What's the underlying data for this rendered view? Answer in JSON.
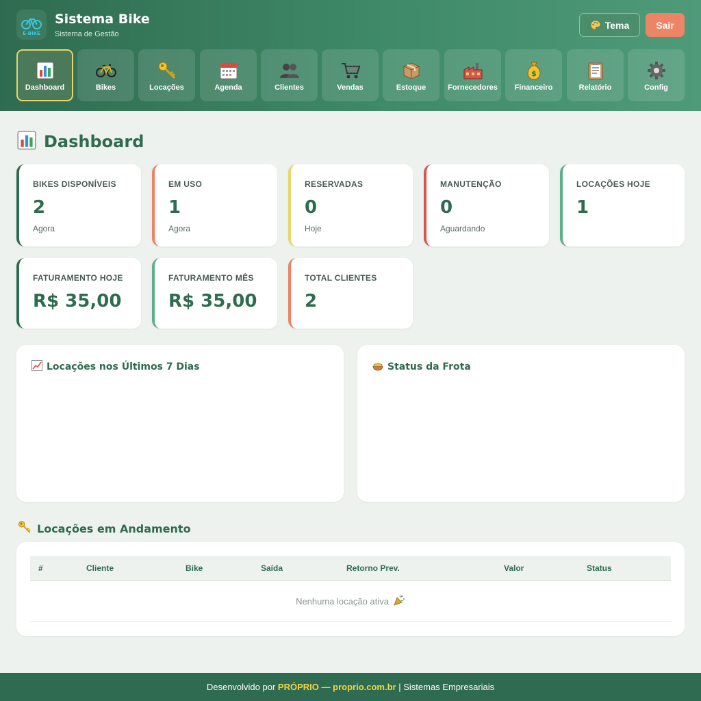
{
  "header": {
    "logo_text": "E-BIKE",
    "title": "Sistema Bike",
    "subtitle": "Sistema de Gestão",
    "theme_button": "Tema",
    "logout_button": "Sair"
  },
  "nav": {
    "items": [
      {
        "label": "Dashboard",
        "icon": "bar-chart-icon",
        "active": true
      },
      {
        "label": "Bikes",
        "icon": "bicycle-icon"
      },
      {
        "label": "Locações",
        "icon": "key-icon"
      },
      {
        "label": "Agenda",
        "icon": "calendar-icon"
      },
      {
        "label": "Clientes",
        "icon": "users-icon"
      },
      {
        "label": "Vendas",
        "icon": "cart-icon"
      },
      {
        "label": "Estoque",
        "icon": "box-icon"
      },
      {
        "label": "Fornecedores",
        "icon": "factory-icon"
      },
      {
        "label": "Financeiro",
        "icon": "money-bag-icon"
      },
      {
        "label": "Relatório",
        "icon": "clipboard-icon"
      },
      {
        "label": "Config",
        "icon": "gear-icon"
      }
    ]
  },
  "page": {
    "title": "Dashboard"
  },
  "stats": [
    {
      "label": "BIKES DISPONÍVEIS",
      "value": "2",
      "note": "Agora",
      "color": "#2f6b50"
    },
    {
      "label": "EM USO",
      "value": "1",
      "note": "Agora",
      "color": "#ee8466"
    },
    {
      "label": "RESERVADAS",
      "value": "0",
      "note": "Hoje",
      "color": "#e8d66a"
    },
    {
      "label": "MANUTENÇÃO",
      "value": "0",
      "note": "Aguardando",
      "color": "#d9534f"
    },
    {
      "label": "LOCAÇÕES HOJE",
      "value": "1",
      "note": "",
      "color": "#5cb08a"
    },
    {
      "label": "FATURAMENTO HOJE",
      "value": "R$ 35,00",
      "note": "",
      "color": "#2f6b50"
    },
    {
      "label": "FATURAMENTO MÊS",
      "value": "R$ 35,00",
      "note": "",
      "color": "#5cb08a"
    },
    {
      "label": "TOTAL CLIENTES",
      "value": "2",
      "note": "",
      "color": "#ee8466"
    }
  ],
  "panels": {
    "rentals_chart_title": "Locações nos Últimos 7 Dias",
    "fleet_status_title": "Status da Frota"
  },
  "active_rentals": {
    "title": "Locações em Andamento",
    "columns": [
      "#",
      "Cliente",
      "Bike",
      "Saída",
      "Retorno Prev.",
      "Valor",
      "Status"
    ],
    "empty_message": "Nenhuma locação ativa"
  },
  "footer": {
    "prefix": "Desenvolvido por",
    "brand": "PRÓPRIO",
    "separator": "—",
    "site": "proprio.com.br",
    "suffix": "| Sistemas Empresariais"
  },
  "colors": {
    "primary": "#2f6b50",
    "accent": "#ee8466",
    "warning": "#e8d66a",
    "danger": "#d9534f",
    "success": "#5cb08a"
  }
}
